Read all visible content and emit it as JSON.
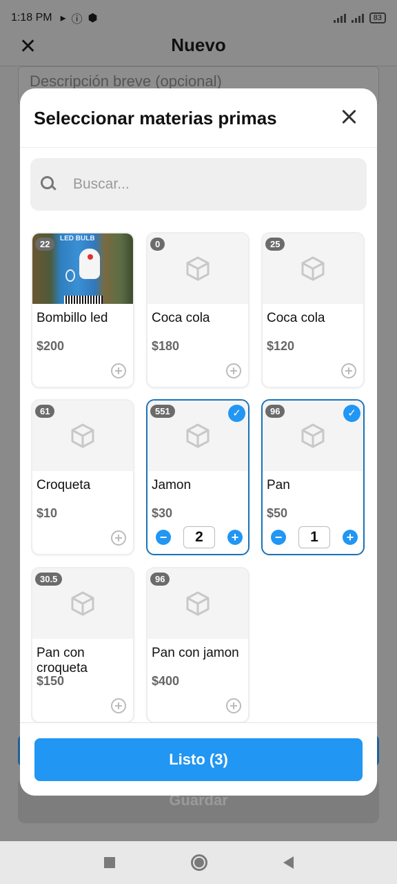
{
  "status_bar": {
    "time": "1:18 PM",
    "battery": "83"
  },
  "app_header": {
    "title": "Nuevo"
  },
  "background_form": {
    "description_placeholder": "Descripción breve (opcional)",
    "save_label": "Guardar"
  },
  "modal": {
    "title": "Seleccionar materias primas",
    "search_placeholder": "Buscar...",
    "done_label": "Listo (3)",
    "items": [
      {
        "name": "Bombillo led",
        "price": "$200",
        "stock": "22",
        "has_photo": true,
        "selected": false
      },
      {
        "name": "Coca cola",
        "price": "$180",
        "stock": "0",
        "has_photo": false,
        "selected": false
      },
      {
        "name": "Coca cola",
        "price": "$120",
        "stock": "25",
        "has_photo": false,
        "selected": false
      },
      {
        "name": "Croqueta",
        "price": "$10",
        "stock": "61",
        "has_photo": false,
        "selected": false
      },
      {
        "name": "Jamon",
        "price": "$30",
        "stock": "551",
        "has_photo": false,
        "selected": true,
        "quantity": "2"
      },
      {
        "name": "Pan",
        "price": "$50",
        "stock": "96",
        "has_photo": false,
        "selected": true,
        "quantity": "1"
      },
      {
        "name": "Pan con croqueta",
        "price": "$150",
        "stock": "30.5",
        "has_photo": false,
        "selected": false
      },
      {
        "name": "Pan con jamon",
        "price": "$400",
        "stock": "96",
        "has_photo": false,
        "selected": false
      }
    ]
  },
  "colors": {
    "accent": "#2196f3",
    "selected_border": "#1a73b9",
    "badge": "#6b6b6b"
  }
}
